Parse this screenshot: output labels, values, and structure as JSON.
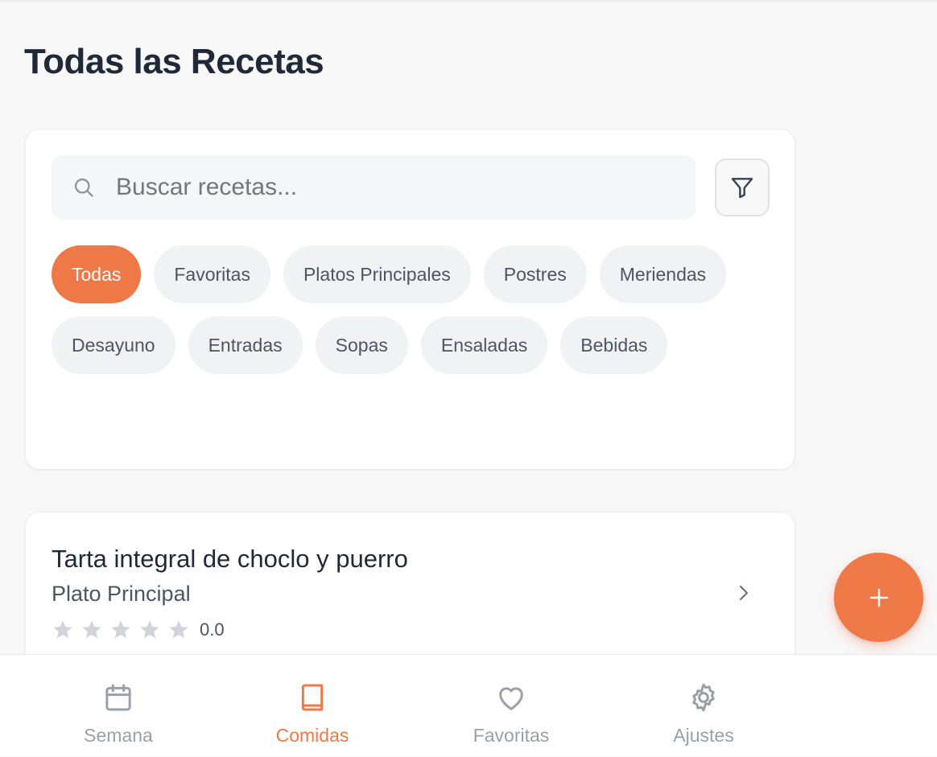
{
  "header": {
    "title": "Todas las Recetas"
  },
  "search": {
    "placeholder": "Buscar recetas...",
    "value": ""
  },
  "filter_button": {
    "icon": "filter-icon"
  },
  "categories": [
    {
      "label": "Todas",
      "active": true
    },
    {
      "label": "Favoritas",
      "active": false
    },
    {
      "label": "Platos Principales",
      "active": false
    },
    {
      "label": "Postres",
      "active": false
    },
    {
      "label": "Meriendas",
      "active": false
    },
    {
      "label": "Desayuno",
      "active": false
    },
    {
      "label": "Entradas",
      "active": false
    },
    {
      "label": "Sopas",
      "active": false
    },
    {
      "label": "Ensaladas",
      "active": false
    },
    {
      "label": "Bebidas",
      "active": false
    }
  ],
  "recipes": [
    {
      "title": "Tarta integral de choclo y puerro",
      "category": "Plato Principal",
      "rating": 0.0,
      "rating_display": "0.0",
      "stars_max": 5
    }
  ],
  "fab": {
    "icon": "plus-icon"
  },
  "bottom_nav": [
    {
      "label": "Semana",
      "icon": "calendar-icon",
      "active": false
    },
    {
      "label": "Comidas",
      "icon": "book-icon",
      "active": true
    },
    {
      "label": "Favoritas",
      "icon": "heart-icon",
      "active": false
    },
    {
      "label": "Ajustes",
      "icon": "gear-icon",
      "active": false
    }
  ],
  "colors": {
    "accent": "#ef7847",
    "text_primary": "#1f2937",
    "text_secondary": "#4b5563",
    "muted": "#9aa0a8",
    "star_empty": "#d1d5db"
  }
}
